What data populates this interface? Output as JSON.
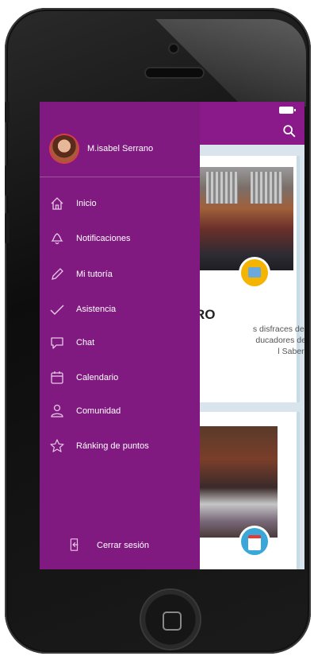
{
  "drawer": {
    "user_name": "M.isabel Serrano",
    "items": [
      {
        "label": "Inicio",
        "icon": "home-icon"
      },
      {
        "label": "Notificaciones",
        "icon": "bell-icon"
      },
      {
        "label": "Mi tutoría",
        "icon": "pencil-icon"
      },
      {
        "label": "Asistencia",
        "icon": "check-icon"
      },
      {
        "label": "Chat",
        "icon": "chat-icon"
      },
      {
        "label": "Calendario",
        "icon": "calendar-icon"
      },
      {
        "label": "Comunidad",
        "icon": "community-icon"
      },
      {
        "label": "Ránking de puntos",
        "icon": "star-icon"
      }
    ],
    "logout_label": "Cerrar sesión"
  },
  "feed": {
    "card1_title": "RO",
    "card1_text": [
      "s disfraces del",
      "ducadores de",
      "l Saber."
    ]
  },
  "colors": {
    "drawer_bg": "#811a80",
    "topbar_bg": "#8a1a8a",
    "feed_bg": "#d9e4ec"
  }
}
